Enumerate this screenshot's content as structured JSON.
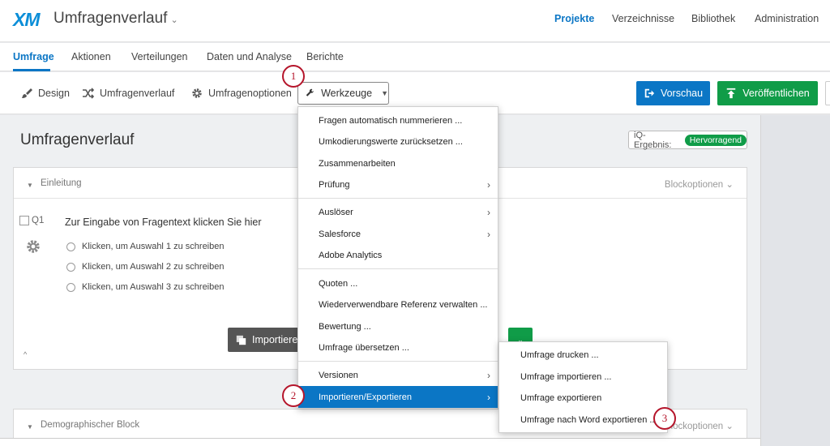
{
  "header": {
    "logo": "XM",
    "project_title": "Umfragenverlauf",
    "nav": [
      "Projekte",
      "Verzeichnisse",
      "Bibliothek",
      "Administration"
    ]
  },
  "tabs": [
    "Umfrage",
    "Aktionen",
    "Verteilungen",
    "Daten und Analyse",
    "Berichte"
  ],
  "toolbar": {
    "design": "Design",
    "flow": "Umfragenverlauf",
    "options": "Umfragenoptionen",
    "tools": "Werkzeuge",
    "preview": "Vorschau",
    "publish": "Veröffentlichen"
  },
  "page": {
    "title": "Umfragenverlauf",
    "iq_label": "iQ-Ergebnis:",
    "iq_value": "Hervorragend"
  },
  "block1": {
    "title": "Einleitung",
    "options": "Blockoptionen",
    "question_number": "Q1",
    "question_text": "Zur Eingabe von Fragentext klicken Sie hier",
    "choices": [
      "Klicken, um Auswahl 1 zu schreiben",
      "Klicken, um Auswahl 2 zu schreiben",
      "Klicken, um Auswahl 3 zu schreiben"
    ],
    "import_label": "Importiere"
  },
  "block2": {
    "title": "Demographischer Block",
    "options": "Blockoptionen"
  },
  "menu": [
    "Fragen automatisch nummerieren ...",
    "Umkodierungswerte zurücksetzen ...",
    "Zusammenarbeiten",
    "Prüfung",
    "Auslöser",
    "Salesforce",
    "Adobe Analytics",
    "Quoten ...",
    "Wiederverwendbare Referenz verwalten ...",
    "Bewertung ...",
    "Umfrage übersetzen ...",
    "Versionen",
    "Importieren/Exportieren"
  ],
  "submenu": [
    "Umfrage drucken ...",
    "Umfrage importieren ...",
    "Umfrage exportieren",
    "Umfrage nach Word exportieren ..."
  ],
  "steps": [
    "1",
    "2",
    "3"
  ],
  "colors": {
    "accent_blue": "#0b76c5",
    "publish_green": "#109c48",
    "step_red": "#b5152b"
  }
}
